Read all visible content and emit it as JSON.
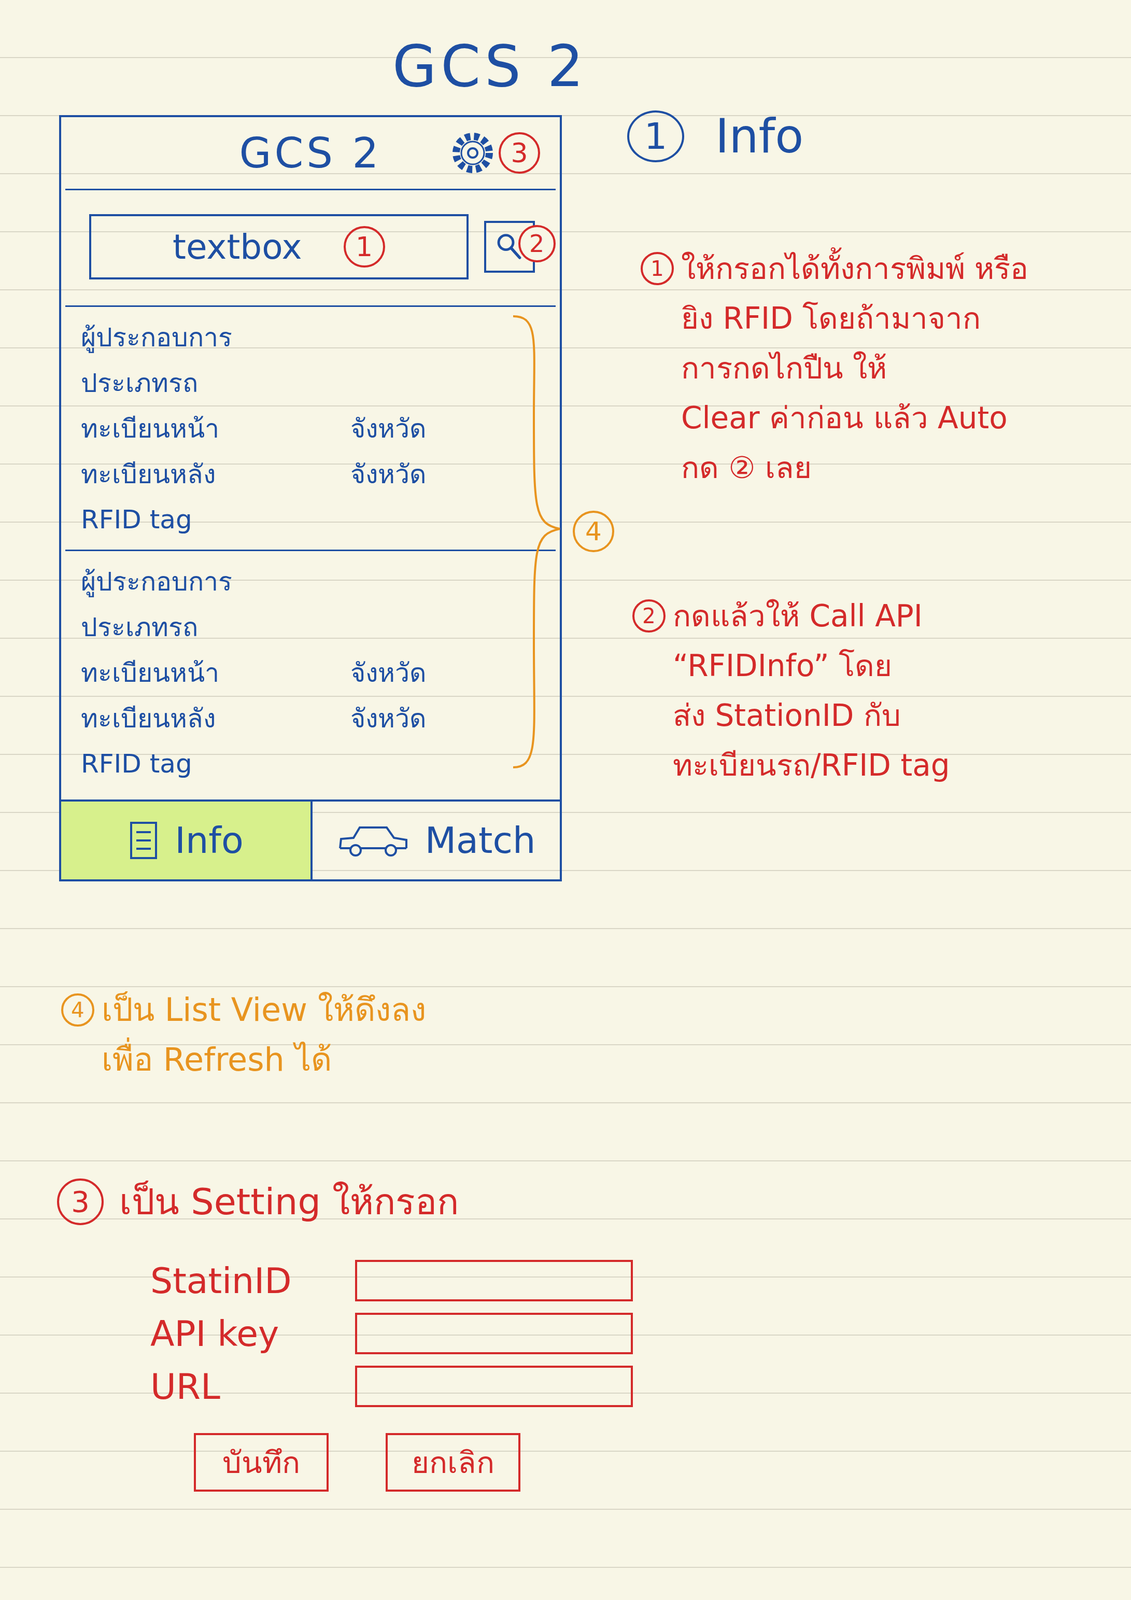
{
  "page_title": "GCS 2",
  "app": {
    "title": "GCS 2",
    "settings_marker": "3",
    "search": {
      "value": "textbox",
      "marker": "1",
      "button_marker": "2"
    },
    "list_marker": "4",
    "records": [
      {
        "rows": [
          [
            "ผู้ประกอบการ"
          ],
          [
            "ประเภทรถ"
          ],
          [
            "ทะเบียนหน้า",
            "จังหวัด"
          ],
          [
            "ทะเบียนหลัง",
            "จังหวัด"
          ],
          [
            "RFID tag"
          ]
        ]
      },
      {
        "rows": [
          [
            "ผู้ประกอบการ"
          ],
          [
            "ประเภทรถ"
          ],
          [
            "ทะเบียนหน้า",
            "จังหวัด"
          ],
          [
            "ทะเบียนหลัง",
            "จังหวัด"
          ],
          [
            "RFID tag"
          ]
        ]
      }
    ],
    "tabs": [
      {
        "label": "Info",
        "selected": true
      },
      {
        "label": "Match",
        "selected": false
      }
    ]
  },
  "section_heading": {
    "marker": "1",
    "text": "Info"
  },
  "notes": [
    {
      "marker": "1",
      "color": "#d42a2a",
      "lines": [
        "ให้กรอกได้ทั้งการพิมพ์ หรือ",
        "ยิง RFID โดยถ้ามาจาก",
        "การกดไกปืน ให้",
        "Clear ค่าก่อน แล้ว Auto",
        "กด ② เลย"
      ]
    },
    {
      "marker": "2",
      "color": "#d42a2a",
      "lines": [
        "กดแล้วให้ Call API",
        "“RFIDInfo” โดย",
        "ส่ง StationID กับ",
        "ทะเบียนรถ/RFID tag"
      ]
    },
    {
      "marker": "4",
      "color": "#e8941f",
      "lines": [
        "เป็น List View ให้ดึงลง",
        "เพื่อ Refresh ได้"
      ]
    }
  ],
  "settings": {
    "marker": "3",
    "heading": "เป็น Setting ให้กรอก",
    "fields": [
      {
        "label": "StatinID",
        "value": ""
      },
      {
        "label": "API key",
        "value": ""
      },
      {
        "label": "URL",
        "value": ""
      }
    ],
    "buttons": [
      "บันทึก",
      "ยกเลิก"
    ]
  }
}
